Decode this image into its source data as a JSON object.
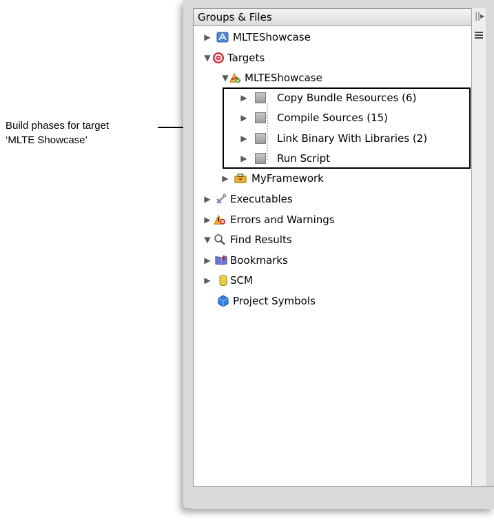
{
  "callout": {
    "line1": "Build phases for target",
    "line2": "‘MLTE Showcase’"
  },
  "pane": {
    "header_title": "Groups & Files",
    "grip": "||▸"
  },
  "tree": {
    "project": "MLTEShowcase",
    "targets": "Targets",
    "target": "MLTEShowcase",
    "phases": [
      "Copy Bundle Resources (6)",
      "Compile Sources (15)",
      "Link Binary With Libraries (2)",
      "Run Script"
    ],
    "framework": "MyFramework",
    "executables": "Executables",
    "errors": "Errors and Warnings",
    "find": "Find Results",
    "bookmarks": "Bookmarks",
    "scm": "SCM",
    "symbols": "Project Symbols"
  },
  "icons": {
    "project": "xcode-project-icon",
    "targets": "target-bullseye-icon",
    "target": "application-target-icon",
    "phase": "build-phase-icon",
    "framework": "framework-toolbox-icon",
    "executables": "executable-icon",
    "errors": "warning-error-icon",
    "find": "magnifier-icon",
    "bookmarks": "bookmark-book-icon",
    "scm": "scm-cylinder-icon",
    "symbols": "symbols-cube-icon"
  },
  "colors": {
    "pane_bg": "#ffffff",
    "window_bg": "#d9d9d9",
    "targets_red": "#e0202a",
    "project_blue": "#4f86d8"
  }
}
